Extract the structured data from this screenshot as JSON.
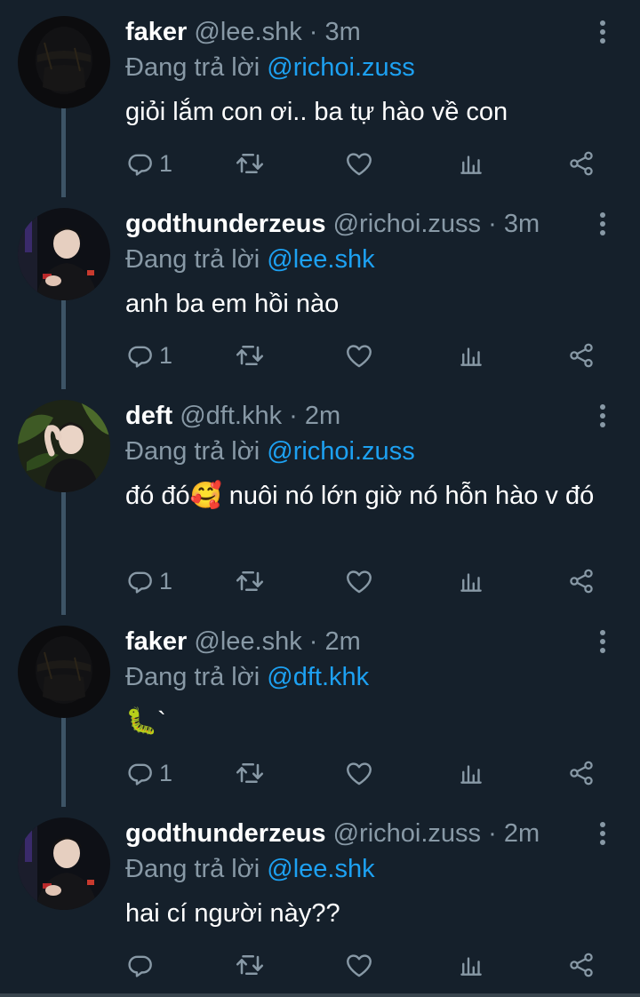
{
  "reply_prefix": "Đang trả lời",
  "colors": {
    "background": "#15202b",
    "text": "#ffffff",
    "muted": "#8899a6",
    "link": "#1da1f2",
    "thread_line": "#3d5466"
  },
  "tweets": [
    {
      "name": "faker",
      "handle": "@lee.shk",
      "separator": "·",
      "time": "3m",
      "reply_to": "@richoi.zuss",
      "text": "giỏi lắm con ơi.. ba tự hào về con",
      "reply_count": "1",
      "avatar": "masked-person-avatar"
    },
    {
      "name": "godthunderzeus",
      "handle": "@richoi.zuss",
      "separator": "·",
      "time": "3m",
      "reply_to": "@lee.shk",
      "text": "anh ba em hồi nào",
      "reply_count": "1",
      "avatar": "young-man-avatar"
    },
    {
      "name": "deft",
      "handle": "@dft.khk",
      "separator": "·",
      "time": "2m",
      "reply_to": "@richoi.zuss",
      "text": "đó đó🥰 nuôi nó lớn giờ nó hỗn hào v đó",
      "reply_count": "1",
      "avatar": "man-with-plants-avatar"
    },
    {
      "name": "faker",
      "handle": "@lee.shk",
      "separator": "·",
      "time": "2m",
      "reply_to": "@dft.khk",
      "text": "🐛`",
      "reply_count": "1",
      "avatar": "masked-person-avatar"
    },
    {
      "name": "godthunderzeus",
      "handle": "@richoi.zuss",
      "separator": "·",
      "time": "2m",
      "reply_to": "@lee.shk",
      "text": "hai cí người này??",
      "reply_count": "",
      "avatar": "young-man-avatar"
    }
  ]
}
